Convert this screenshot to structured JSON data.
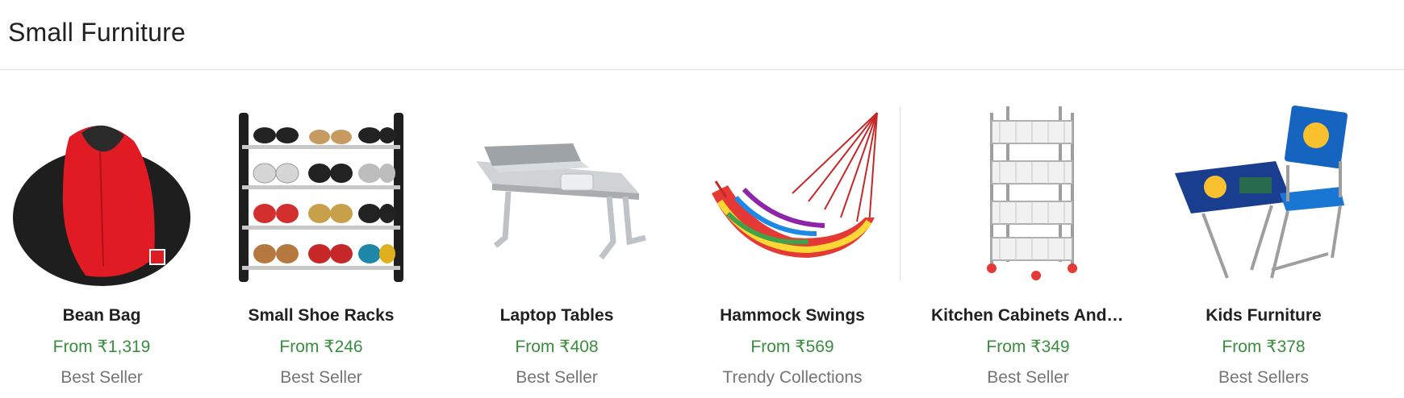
{
  "section": {
    "title": "Small Furniture"
  },
  "products": [
    {
      "name": "Bean Bag",
      "price": "From ₹1,319",
      "tag": "Best Seller",
      "icon": "bean-bag-image"
    },
    {
      "name": "Small Shoe Racks",
      "price": "From ₹246",
      "tag": "Best Seller",
      "icon": "shoe-rack-image"
    },
    {
      "name": "Laptop Tables",
      "price": "From ₹408",
      "tag": "Best Seller",
      "icon": "laptop-table-image"
    },
    {
      "name": "Hammock Swings",
      "price": "From ₹569",
      "tag": "Trendy Collections",
      "icon": "hammock-image"
    },
    {
      "name": "Kitchen Cabinets And Tr...",
      "price": "From ₹349",
      "tag": "Best Seller",
      "icon": "kitchen-trolley-image"
    },
    {
      "name": "Kids Furniture",
      "price": "From ₹378",
      "tag": "Best Sellers",
      "icon": "kids-furniture-image"
    }
  ],
  "colors": {
    "price": "#388e3c",
    "tag": "#757575",
    "title": "#212121"
  }
}
